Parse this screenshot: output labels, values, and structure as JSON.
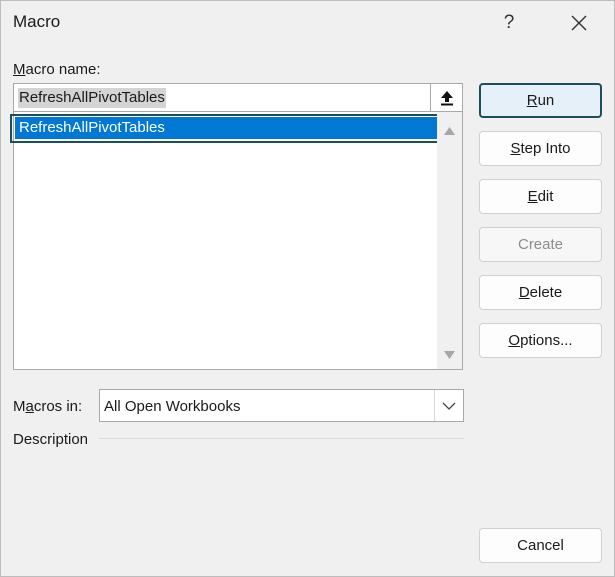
{
  "window": {
    "title": "Macro",
    "help_label": "?"
  },
  "macro_name": {
    "label_accel": "M",
    "label_rest": "acro name:",
    "value": "RefreshAllPivotTables"
  },
  "macro_list": {
    "items": [
      "RefreshAllPivotTables"
    ],
    "selected_index": 0
  },
  "macros_in": {
    "label_pre": "M",
    "label_accel": "a",
    "label_rest": "cros in:",
    "value": "All Open Workbooks"
  },
  "description": {
    "label": "Description"
  },
  "buttons": {
    "run": {
      "accel": "R",
      "rest": "un"
    },
    "step_into": {
      "accel": "S",
      "rest": "tep Into"
    },
    "edit": {
      "accel": "E",
      "rest": "dit"
    },
    "create": {
      "label": "Create"
    },
    "delete": {
      "accel": "D",
      "rest": "elete"
    },
    "options": {
      "accel": "O",
      "rest": "ptions..."
    },
    "cancel": {
      "label": "Cancel"
    }
  },
  "icons": {
    "help": "question-mark-icon",
    "close": "close-icon",
    "upload": "arrow-up-icon",
    "scroll_up": "triangle-up-icon",
    "scroll_down": "triangle-down-icon",
    "dropdown": "chevron-down-icon"
  },
  "colors": {
    "selection": "#0078d4",
    "focus_border": "#1d4f5a",
    "primary_button_bg": "#e6f0f8"
  }
}
